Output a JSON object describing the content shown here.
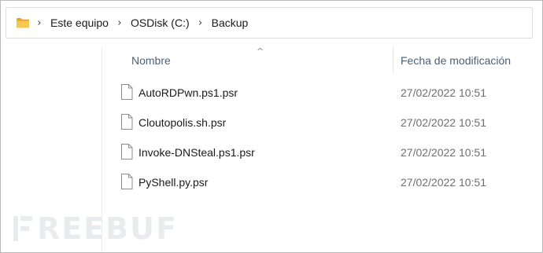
{
  "address_bar": {
    "icon": "folder-icon",
    "separator": "›",
    "crumbs": [
      "Este equipo",
      "OSDisk (C:)",
      "Backup"
    ]
  },
  "columns": {
    "name_header": "Nombre",
    "date_header": "Fecha de modificación",
    "sort_indicator": "^"
  },
  "files": [
    {
      "name": "AutoRDPwn.ps1.psr",
      "modified": "27/02/2022 10:51",
      "icon": "document-icon"
    },
    {
      "name": "Cloutopolis.sh.psr",
      "modified": "27/02/2022 10:51",
      "icon": "document-icon"
    },
    {
      "name": "Invoke-DNSteal.ps1.psr",
      "modified": "27/02/2022 10:51",
      "icon": "document-icon"
    },
    {
      "name": "PyShell.py.psr",
      "modified": "27/02/2022 10:51",
      "icon": "document-icon"
    }
  ],
  "watermark": {
    "text": "REEBUF",
    "color": "#e9ecef"
  },
  "colors": {
    "folder": "#f2c14e",
    "header_text": "#4c607a",
    "date_text": "#6e6e6e"
  }
}
